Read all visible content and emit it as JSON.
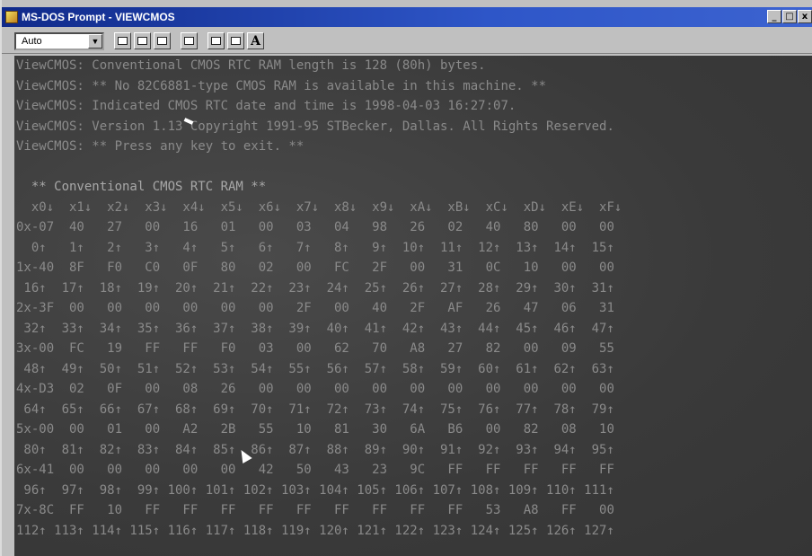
{
  "window": {
    "title": "MS-DOS Prompt - VIEWCMOS",
    "buttons": {
      "minimize": "_",
      "maximize": "□",
      "close": "x"
    }
  },
  "toolbar": {
    "font_size_value": "Auto",
    "font_button_label": "A",
    "icons": [
      "mark-icon",
      "copy-icon",
      "paste-icon",
      "fullscreen-icon",
      "properties-icon",
      "background-icon",
      "font-icon"
    ]
  },
  "console": {
    "lines": [
      "ViewCMOS: Conventional CMOS RTC RAM length is 128 (80h) bytes.",
      "ViewCMOS: ** No 82C6881-type CMOS RAM is available in this machine. **",
      "ViewCMOS: Indicated CMOS RTC date and time is 1998-04-03 16:27:07.",
      "ViewCMOS: Version 1.13 Copyright 1991-95 STBecker, Dallas. All Rights Reserved.",
      "ViewCMOS: ** Press any key to exit. **",
      "",
      "  ** Conventional CMOS RTC RAM **",
      "  x0↓  x1↓  x2↓  x3↓  x4↓  x5↓  x6↓  x7↓  x8↓  x9↓  xA↓  xB↓  xC↓  xD↓  xE↓  xF↓",
      "0x-07  40   27   00   16   01   00   03   04   98   26   02   40   80   00   00",
      "  0↑   1↑   2↑   3↑   4↑   5↑   6↑   7↑   8↑   9↑  10↑  11↑  12↑  13↑  14↑  15↑",
      "1x-40  8F   F0   C0   0F   80   02   00   FC   2F   00   31   0C   10   00   00",
      " 16↑  17↑  18↑  19↑  20↑  21↑  22↑  23↑  24↑  25↑  26↑  27↑  28↑  29↑  30↑  31↑",
      "2x-3F  00   00   00   00   00   00   2F   00   40   2F   AF   26   47   06   31",
      " 32↑  33↑  34↑  35↑  36↑  37↑  38↑  39↑  40↑  41↑  42↑  43↑  44↑  45↑  46↑  47↑",
      "3x-00  FC   19   FF   FF   F0   03   00   62   70   A8   27   82   00   09   55",
      " 48↑  49↑  50↑  51↑  52↑  53↑  54↑  55↑  56↑  57↑  58↑  59↑  60↑  61↑  62↑  63↑",
      "4x-D3  02   0F   00   08   26   00   00   00   00   00   00   00   00   00   00",
      " 64↑  65↑  66↑  67↑  68↑  69↑  70↑  71↑  72↑  73↑  74↑  75↑  76↑  77↑  78↑  79↑",
      "5x-00  00   01   00   A2   2B   55   10   81   30   6A   B6   00   82   08   10",
      " 80↑  81↑  82↑  83↑  84↑  85↑  86↑  87↑  88↑  89↑  90↑  91↑  92↑  93↑  94↑  95↑",
      "6x-41  00   00   00   00   00   42   50   43   23   9C   FF   FF   FF   FF   FF",
      " 96↑  97↑  98↑  99↑ 100↑ 101↑ 102↑ 103↑ 104↑ 105↑ 106↑ 107↑ 108↑ 109↑ 110↑ 111↑",
      "7x-8C  FF   10   FF   FF   FF   FF   FF   FF   FF   FF   FF   53   A8   FF   00",
      "112↑ 113↑ 114↑ 115↑ 116↑ 117↑ 118↑ 119↑ 120↑ 121↑ 122↑ 123↑ 124↑ 125↑ 126↑ 127↑"
    ]
  }
}
